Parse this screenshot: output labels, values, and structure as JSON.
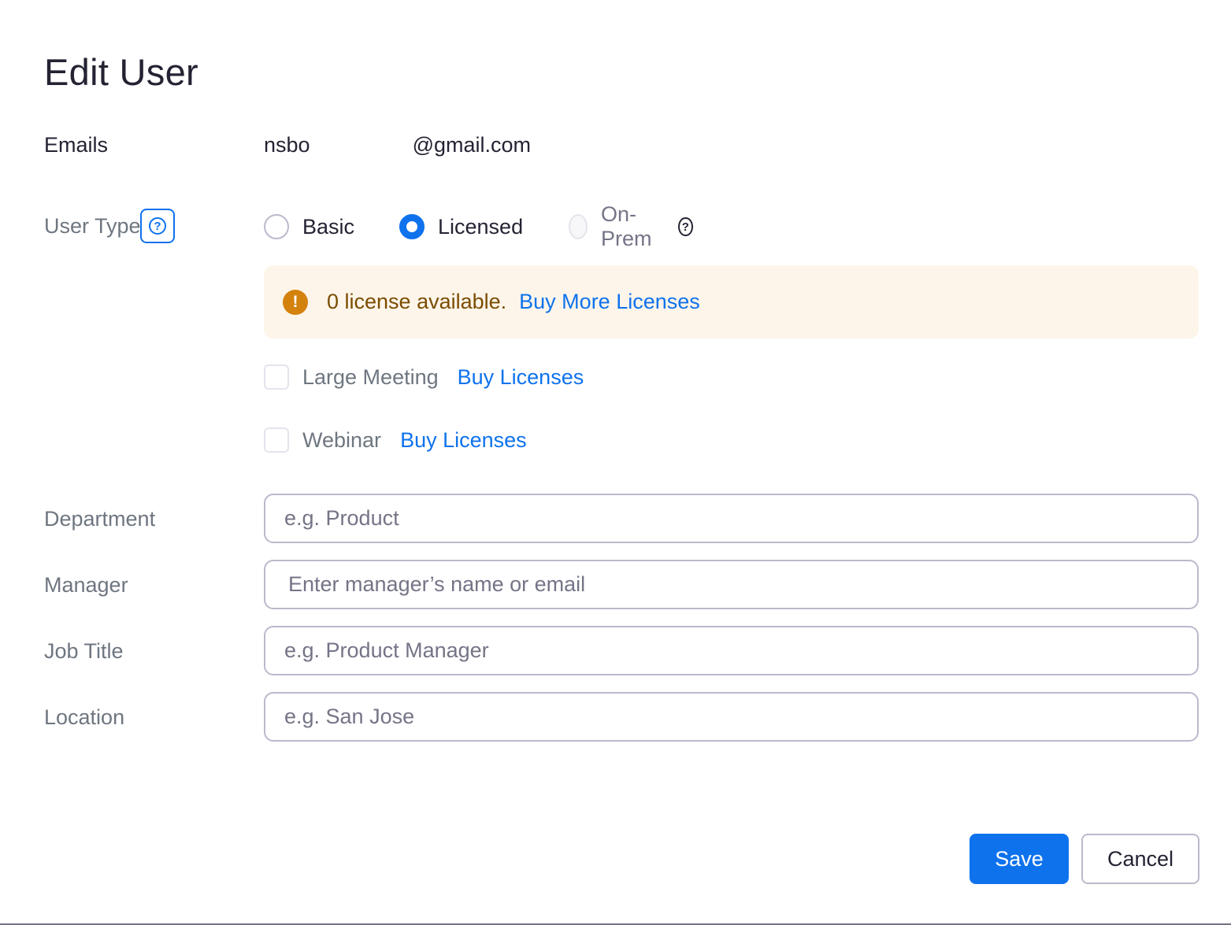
{
  "title": "Edit User",
  "emails": {
    "label": "Emails",
    "value_start": "nsbo",
    "value_end": "@gmail.com"
  },
  "user_type": {
    "label": "User Type",
    "help_glyph": "?",
    "options": [
      {
        "label": "Basic",
        "state": "unchecked"
      },
      {
        "label": "Licensed",
        "state": "checked"
      },
      {
        "label": "On-Prem",
        "state": "disabled"
      }
    ],
    "onprem_help_glyph": "?"
  },
  "alert": {
    "icon_glyph": "!",
    "text": "0 license available.",
    "link": "Buy More Licenses",
    "icon_color": "#d4820e",
    "background": "#fdf5ea"
  },
  "addons": [
    {
      "label": "Large Meeting",
      "checked": false,
      "link": "Buy Licenses"
    },
    {
      "label": "Webinar",
      "checked": false,
      "link": "Buy Licenses"
    }
  ],
  "fields": {
    "department": {
      "label": "Department",
      "placeholder": "e.g. Product",
      "value": ""
    },
    "manager": {
      "label": "Manager",
      "placeholder": "Enter manager’s name or email",
      "value": ""
    },
    "job_title": {
      "label": "Job Title",
      "placeholder": "e.g. Product Manager",
      "value": ""
    },
    "location": {
      "label": "Location",
      "placeholder": "e.g. San Jose",
      "value": ""
    }
  },
  "buttons": {
    "save": "Save",
    "cancel": "Cancel"
  },
  "colors": {
    "accent": "#0e72ed",
    "text": "#232333",
    "muted": "#6e7680"
  }
}
